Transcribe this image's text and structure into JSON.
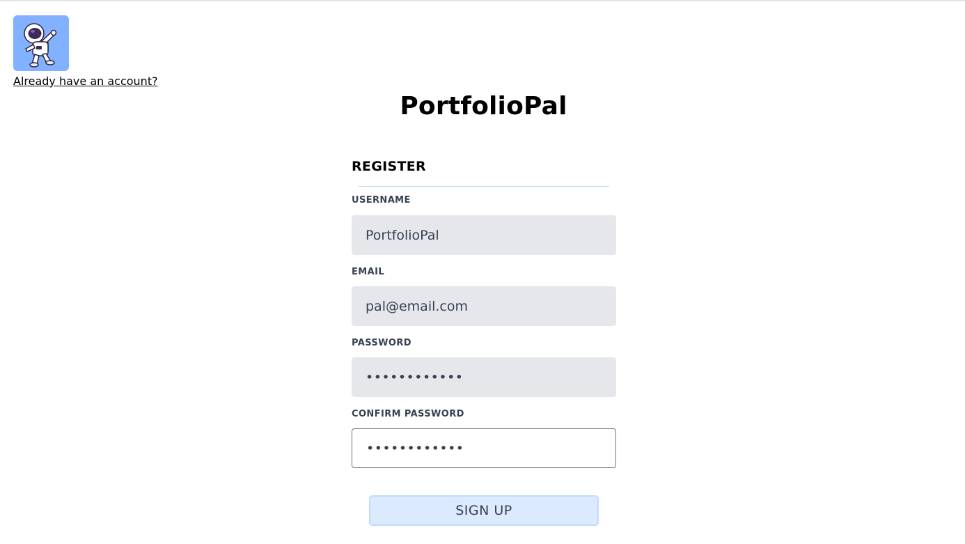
{
  "header": {
    "logo_icon": "astronaut-dabbing-icon",
    "login_link": "Already have an account?"
  },
  "app": {
    "title": "PortfolioPal"
  },
  "register_form": {
    "heading": "REGISTER",
    "fields": [
      {
        "label": "USERNAME",
        "value": "PortfolioPal",
        "type": "text"
      },
      {
        "label": "EMAIL",
        "value": "pal@email.com",
        "type": "email"
      },
      {
        "label": "PASSWORD",
        "value": "passwordpass",
        "type": "password"
      },
      {
        "label": "CONFIRM PASSWORD",
        "value": "passwordpass",
        "type": "password"
      }
    ],
    "submit_label": "SIGN UP"
  },
  "colors": {
    "logo_bg": "#82b1ff",
    "input_bg": "#e5e7eb",
    "button_bg": "#dbeafe",
    "divider": "#b7dedd"
  }
}
